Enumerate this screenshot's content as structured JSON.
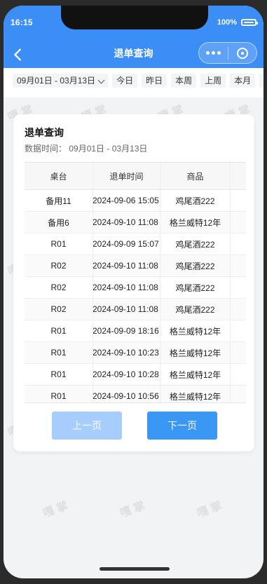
{
  "status_bar": {
    "time": "16:15",
    "battery_label": "100%"
  },
  "nav": {
    "title": "退单查询",
    "icons": {
      "back": "chevron-left-icon",
      "more": "more-dots-icon",
      "target": "target-icon"
    }
  },
  "filters": {
    "range_label": "09月01日 - 03月13日",
    "quick": [
      "今日",
      "昨日",
      "本周",
      "上周",
      "本月",
      "上月"
    ]
  },
  "card": {
    "title": "退单查询",
    "data_time_label": "数据时间：",
    "data_time_value": "09月01日 - 03月13日"
  },
  "table": {
    "headers": [
      "桌台",
      "退单时间",
      "商品"
    ],
    "rows": [
      {
        "table": "备用11",
        "time": "2024-09-06 15:05",
        "item": "鸡尾酒222"
      },
      {
        "table": "备用6",
        "time": "2024-09-10 11:08",
        "item": "格兰威特12年"
      },
      {
        "table": "R01",
        "time": "2024-09-09 15:07",
        "item": "鸡尾酒222"
      },
      {
        "table": "R02",
        "time": "2024-09-10 11:08",
        "item": "鸡尾酒222"
      },
      {
        "table": "R02",
        "time": "2024-09-10 11:08",
        "item": "鸡尾酒222"
      },
      {
        "table": "R02",
        "time": "2024-09-10 11:08",
        "item": "鸡尾酒222"
      },
      {
        "table": "R01",
        "time": "2024-09-09 18:16",
        "item": "格兰威特12年"
      },
      {
        "table": "R01",
        "time": "2024-09-10 10:23",
        "item": "格兰威特12年"
      },
      {
        "table": "R01",
        "time": "2024-09-10 10:28",
        "item": "格兰威特12年"
      },
      {
        "table": "R01",
        "time": "2024-09-10 10:56",
        "item": "格兰威特12年"
      }
    ]
  },
  "pager": {
    "prev_label": "上一页",
    "next_label": "下一页"
  },
  "watermark": {
    "text": "嘎 掌"
  },
  "colors": {
    "header_blue": "#3a8ef6",
    "next_button": "#3a97f4",
    "prev_button_disabled": "#a6cdfb"
  }
}
